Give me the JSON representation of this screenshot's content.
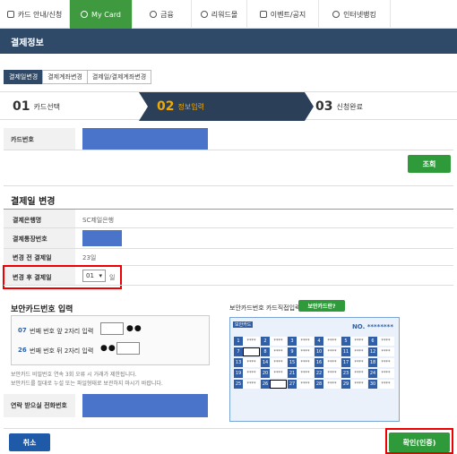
{
  "nav": {
    "tabs": [
      {
        "label": "카드 안내/신청",
        "icon": "card-icon"
      },
      {
        "label": "My Card",
        "icon": "user-icon"
      },
      {
        "label": "금융",
        "icon": "coin-icon"
      },
      {
        "label": "리워드몰",
        "icon": "gift-icon"
      },
      {
        "label": "이벤트/공지",
        "icon": "megaphone-icon"
      },
      {
        "label": "인터넷뱅킹",
        "icon": "hand-icon"
      }
    ],
    "active_color": "#3f9a3f"
  },
  "page": {
    "title": "결제정보"
  },
  "subtabs": [
    "결제일변경",
    "결제계좌변경",
    "결제일/결제계좌변경"
  ],
  "steps": [
    {
      "num": "01",
      "label": "카드선택"
    },
    {
      "num": "02",
      "label": "정보입력"
    },
    {
      "num": "03",
      "label": "신청완료"
    }
  ],
  "card_section": {
    "label": "카드번호",
    "search_button": "조회"
  },
  "payment_change": {
    "title": "결제일 변경",
    "rows": [
      {
        "label": "결제은행명",
        "value": "SC제일은행"
      },
      {
        "label": "결제통장번호",
        "value": ""
      },
      {
        "label": "변경 전 결제일",
        "value": "23일"
      },
      {
        "label": "변경 후 결제일",
        "value": ""
      }
    ],
    "select_value": "01",
    "select_suffix": "일"
  },
  "security": {
    "title": "보안카드번호 입력",
    "line1_num": "07",
    "line1_text": "번째 번호 앞 2자리 입력",
    "line1_dots": "●●",
    "line2_num": "26",
    "line2_text": "번째 번호 뒤 2자리 입력",
    "line2_dots": "●●",
    "notes": [
      "보안카드 비밀번호 연속 3회 오류 시 거래가 제한됩니다.",
      "보안카드를 절대로 누설 또는 파일형태로 보관하지 마시기 바랍니다."
    ],
    "phone_label": "연락 받으실 전화번호",
    "card_label": "보안카드번호 카드직접입력",
    "card_button": "보안카드란?",
    "card_tag": "보안카드",
    "card_no": "NO. ********",
    "cells": [
      "1",
      "2",
      "3",
      "4",
      "5",
      "6",
      "7",
      "8",
      "9",
      "10",
      "11",
      "12",
      "13",
      "14",
      "15",
      "16",
      "17",
      "18",
      "19",
      "20",
      "21",
      "22",
      "23",
      "24",
      "25",
      "26",
      "27",
      "28",
      "29",
      "30"
    ]
  },
  "footer": {
    "cancel": "취소",
    "confirm": "확인(인증)"
  }
}
